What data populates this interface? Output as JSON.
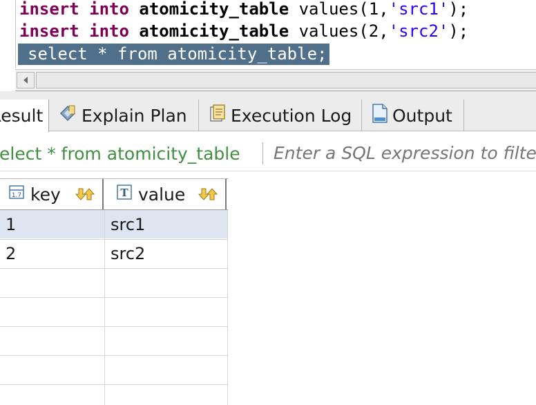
{
  "editor": {
    "lines": [
      {
        "kw1": "insert",
        "kw2": "into",
        "table": "atomicity_table",
        "rest1": " values(1,",
        "str": "'src1'",
        "rest2": ");"
      },
      {
        "kw1": "insert",
        "kw2": "into",
        "table": "atomicity_table",
        "rest1": " values(2,",
        "str": "'src2'",
        "rest2": ");"
      }
    ],
    "selected_line": "select * from atomicity_table;"
  },
  "tabs": [
    {
      "label": "Result",
      "icon": "result-icon",
      "active": true
    },
    {
      "label": "Explain Plan",
      "icon": "explain-plan-icon",
      "active": false
    },
    {
      "label": "Execution Log",
      "icon": "execution-log-icon",
      "active": false
    },
    {
      "label": "Output",
      "icon": "output-icon",
      "active": false
    }
  ],
  "filter": {
    "query": "select * from atomicity_table",
    "placeholder": "Enter a SQL expression to filter results"
  },
  "grid": {
    "columns": [
      {
        "name": "key",
        "type_icon": "numeric-type-icon"
      },
      {
        "name": "value",
        "type_icon": "text-type-icon"
      }
    ],
    "rows": [
      {
        "key": "1",
        "value": "src1",
        "selected": true
      },
      {
        "key": "2",
        "value": "src2",
        "selected": false
      }
    ]
  },
  "colors": {
    "keyword": "#7f0055",
    "string": "#2a00ff",
    "selection_bg": "#4f6f8a",
    "filter_query": "#3f8f3f",
    "selected_row": "#dde6f0"
  }
}
